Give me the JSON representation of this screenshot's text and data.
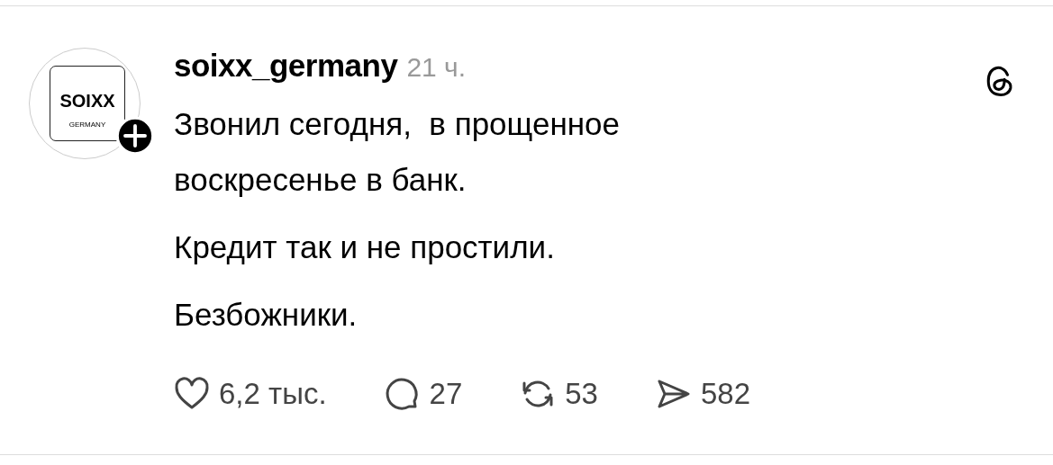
{
  "post": {
    "avatar": {
      "logo_text": "SOIXX",
      "logo_subtext": "GERMANY",
      "follow_badge": true
    },
    "username": "soixx_germany",
    "time": "21 ч.",
    "paragraphs": [
      "Звонил сегодня,  в прощенное воскресенье в банк.",
      "Кредит так и не простили.",
      "Безбожники."
    ],
    "actions": [
      {
        "kind": "like",
        "count": "6,2 тыс."
      },
      {
        "kind": "comment",
        "count": "27"
      },
      {
        "kind": "repost",
        "count": "53"
      },
      {
        "kind": "share",
        "count": "582"
      }
    ]
  }
}
